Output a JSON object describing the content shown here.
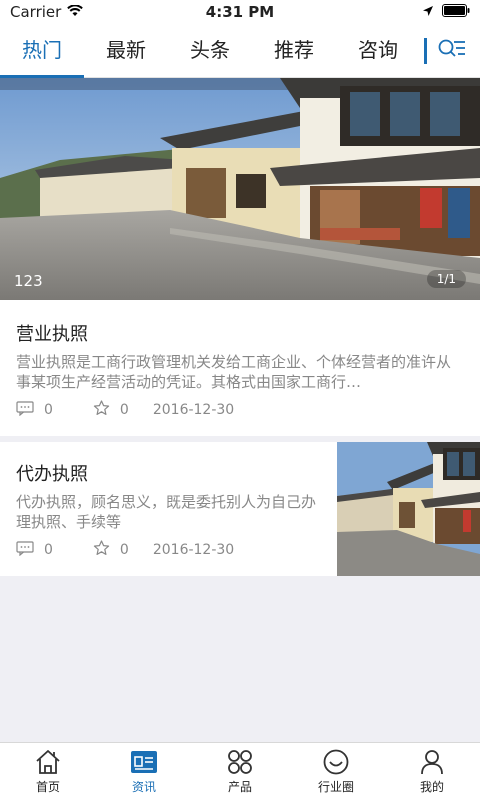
{
  "status": {
    "carrier": "Carrier",
    "time": "4:31 PM"
  },
  "tabs": [
    {
      "label": "热门",
      "active": true
    },
    {
      "label": "最新",
      "active": false
    },
    {
      "label": "头条",
      "active": false
    },
    {
      "label": "推荐",
      "active": false
    },
    {
      "label": "咨询",
      "active": false
    }
  ],
  "banner": {
    "caption": "123",
    "indicator": "1/1"
  },
  "articles": [
    {
      "title": "营业执照",
      "description": "营业执照是工商行政管理机关发给工商企业、个体经营者的准许从事某项生产经营活动的凭证。其格式由国家工商行…",
      "comments": "0",
      "favorites": "0",
      "date": "2016-12-30"
    },
    {
      "title": "代办执照",
      "description": "代办执照，顾名思义，既是委托别人为自己办理执照、手续等",
      "comments": "0",
      "favorites": "0",
      "date": "2016-12-30"
    }
  ],
  "bottom_nav": [
    {
      "label": "首页",
      "icon": "home-icon"
    },
    {
      "label": "资讯",
      "icon": "news-icon",
      "active": true
    },
    {
      "label": "产品",
      "icon": "products-icon"
    },
    {
      "label": "行业圈",
      "icon": "industry-circle-icon"
    },
    {
      "label": "我的",
      "icon": "profile-icon"
    }
  ],
  "colors": {
    "accent": "#1a6fb5",
    "text": "#222222",
    "muted": "#888888",
    "background": "#efeff4"
  }
}
